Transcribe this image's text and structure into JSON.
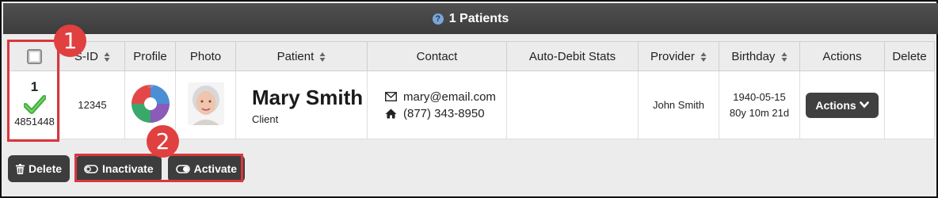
{
  "header": {
    "help_icon": "question-circle-icon",
    "title": "1 Patients"
  },
  "table": {
    "columns": {
      "select": "",
      "id": "S-ID",
      "profile": "Profile",
      "photo": "Photo",
      "patient": "Patient",
      "contact": "Contact",
      "autodebit": "Auto-Debit Stats",
      "provider": "Provider",
      "birthday": "Birthday",
      "actions": "Actions",
      "delete": "Delete"
    },
    "row": {
      "number": "1",
      "code": "4851448",
      "id": "12345",
      "patient_name": "Mary Smith",
      "patient_role": "Client",
      "email": "mary@email.com",
      "phone": "(877) 343-8950",
      "provider": "John Smith",
      "birth_date": "1940-05-15",
      "age": "80y 10m 21d",
      "actions_label": "Actions"
    }
  },
  "buttons": {
    "delete": "Delete",
    "inactivate": "Inactivate",
    "activate": "Activate"
  },
  "callouts": {
    "one": "1",
    "two": "2"
  },
  "colors": {
    "header_bg": "#444444",
    "callout_red": "#d9373d",
    "check_green": "#3fae3a"
  }
}
